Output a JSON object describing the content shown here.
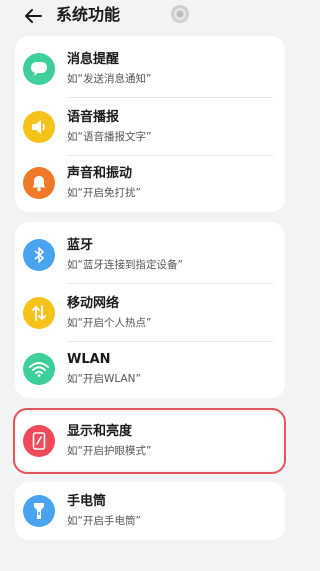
{
  "header": {
    "title": "系统功能",
    "back_icon": "back-arrow-icon"
  },
  "groups": [
    {
      "items": [
        {
          "title": "消息提醒",
          "subtitle": "如“发送消息通知”",
          "icon": "chat-bubble-icon",
          "color": "#3ecf9b"
        },
        {
          "title": "语音播报",
          "subtitle": "如“语音播报文字”",
          "icon": "speaker-icon",
          "color": "#f5c21b"
        },
        {
          "title": "声音和振动",
          "subtitle": "如“开启免打扰”",
          "icon": "bell-icon",
          "color": "#f07a2a"
        }
      ]
    },
    {
      "items": [
        {
          "title": "蓝牙",
          "subtitle": "如“蓝牙连接到指定设备”",
          "icon": "bluetooth-icon",
          "color": "#4aa3f0"
        },
        {
          "title": "移动网络",
          "subtitle": "如“开启个人热点”",
          "icon": "mobile-data-icon",
          "color": "#f5c21b"
        },
        {
          "title": "WLAN",
          "subtitle": "如“开启WLAN”",
          "icon": "wifi-icon",
          "color": "#3ecf9b"
        }
      ]
    },
    {
      "items": [
        {
          "title": "显示和亮度",
          "subtitle": "如“开启护眼模式”",
          "icon": "display-icon",
          "color": "#f04a5a"
        }
      ]
    },
    {
      "items": [
        {
          "title": "手电筒",
          "subtitle": "如“开启手电筒”",
          "icon": "flashlight-icon",
          "color": "#4aa3f0"
        }
      ]
    }
  ],
  "highlight_color": "#e2555e"
}
